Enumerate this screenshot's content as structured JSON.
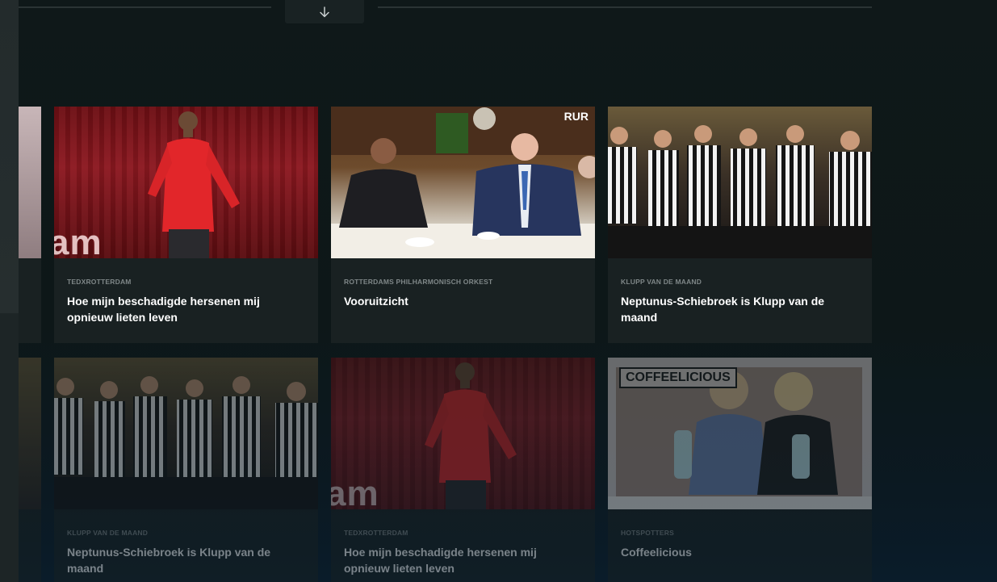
{
  "nav": {
    "scroll_down_icon": "arrow-down-icon"
  },
  "colors": {
    "background": "#0d1617",
    "card": "#192122",
    "category_text": "#7f8788",
    "title_text": "#ffffff"
  },
  "grid": {
    "rows": [
      {
        "cards": [
          {
            "category": "TEDxROTTERDAM",
            "title": "Hoe mijn beschadigde hersenen mij opnieuw lieten leven",
            "thumb": "ted"
          },
          {
            "category": "ROTTERDAMS PHILHARMONISCH ORKEST",
            "title": "Vooruitzicht",
            "thumb": "dinner"
          },
          {
            "category": "KLUPP VAN DE MAAND",
            "title": "Neptunus-Schiebroek is Klupp van de maand",
            "thumb": "team"
          }
        ]
      },
      {
        "cards": [
          {
            "category": "KLUPP VAN DE MAAND",
            "title": "Neptunus-Schiebroek is Klupp van de maand",
            "thumb": "team"
          },
          {
            "category": "TEDxROTTERDAM",
            "title": "Hoe mijn beschadigde hersenen mij opnieuw lieten leven",
            "thumb": "ted"
          },
          {
            "category": "HOTSPOTTERS",
            "title": "Coffeelicious",
            "thumb": "coffee"
          }
        ]
      }
    ]
  },
  "thumb_text": {
    "ted_logo": "am",
    "rur_mark": "RUR",
    "coffee_badge": "COFFEELICIOUS"
  }
}
